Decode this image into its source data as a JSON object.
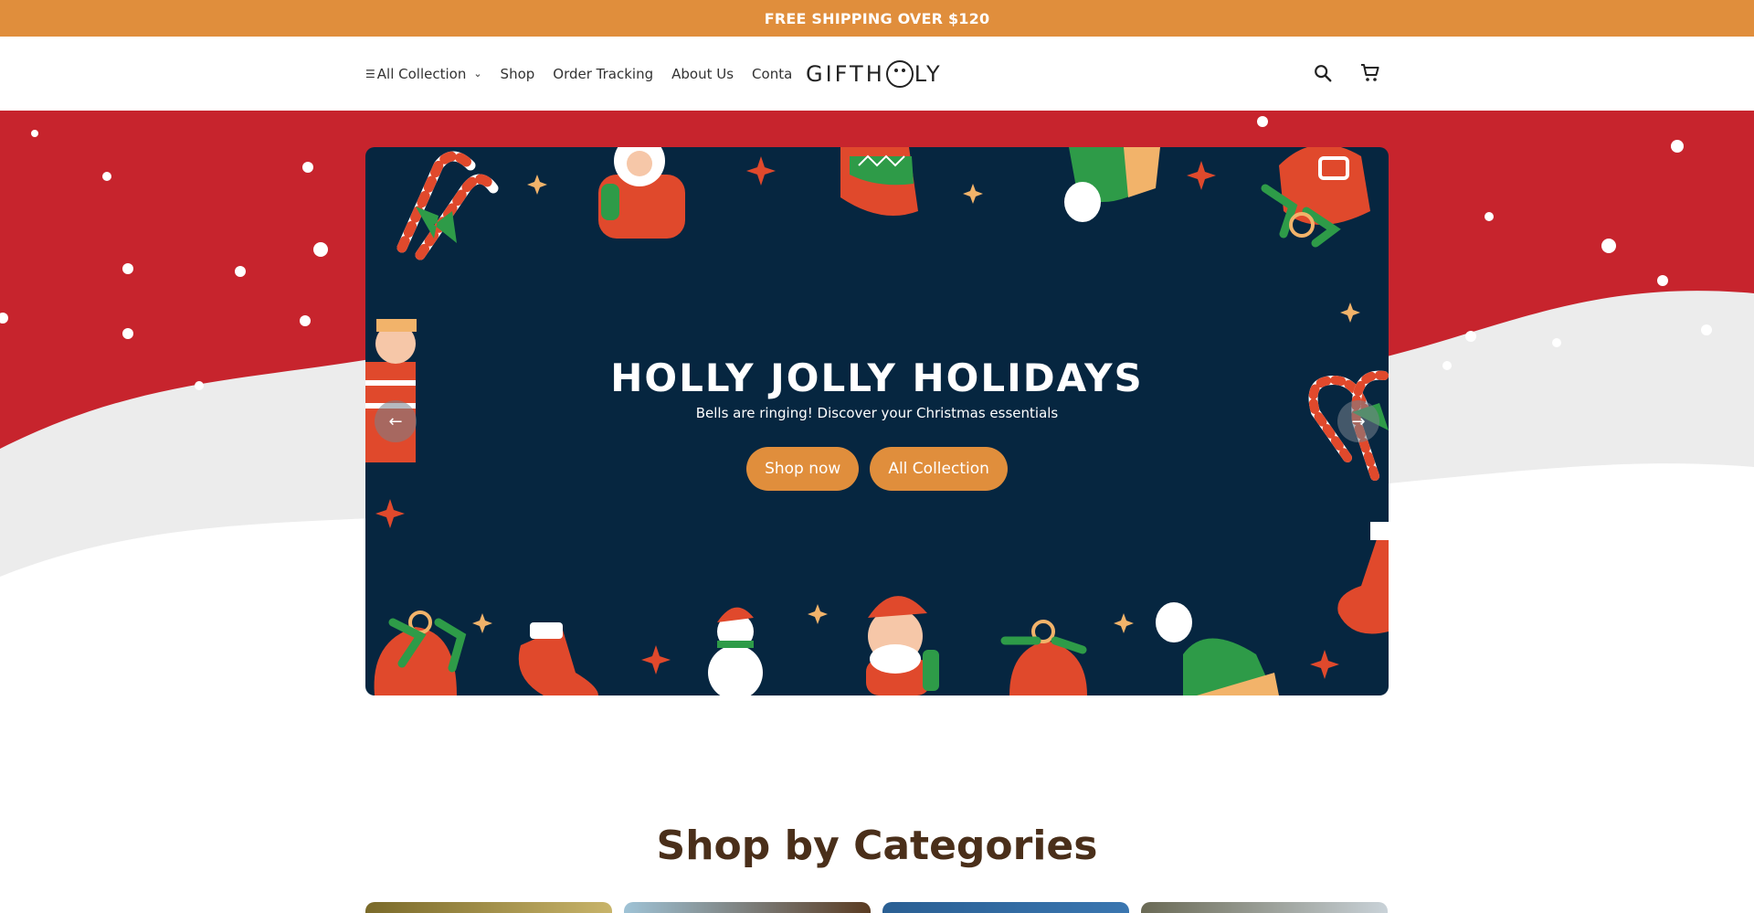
{
  "announcement": {
    "text": "FREE SHIPPING OVER $120"
  },
  "nav": {
    "items": [
      {
        "label": "All Collection",
        "icon": "list-icon",
        "has_dropdown": true
      },
      {
        "label": "Shop"
      },
      {
        "label": "Order Tracking"
      },
      {
        "label": "About Us"
      },
      {
        "label": "Conta"
      }
    ]
  },
  "logo": {
    "text_left": "GIFTH",
    "text_right": "LY",
    "icon": "dog-face-icon"
  },
  "header_icons": {
    "search": "search-icon",
    "cart": "cart-icon"
  },
  "hero": {
    "title": "HOLLY JOLLY HOLIDAYS",
    "subtitle": "Bells are ringing! Discover your Christmas essentials",
    "buttons": [
      {
        "label": "Shop now"
      },
      {
        "label": "All Collection"
      }
    ],
    "prev_icon": "arrow-left-icon",
    "next_icon": "arrow-right-icon"
  },
  "categories": {
    "title": "Shop by Categories"
  },
  "colors": {
    "accent": "#e08e3c",
    "hero_bg": "#062640",
    "backdrop_red": "#c7242d",
    "snow": "#ececec",
    "heading_brown": "#4a2f1a"
  }
}
